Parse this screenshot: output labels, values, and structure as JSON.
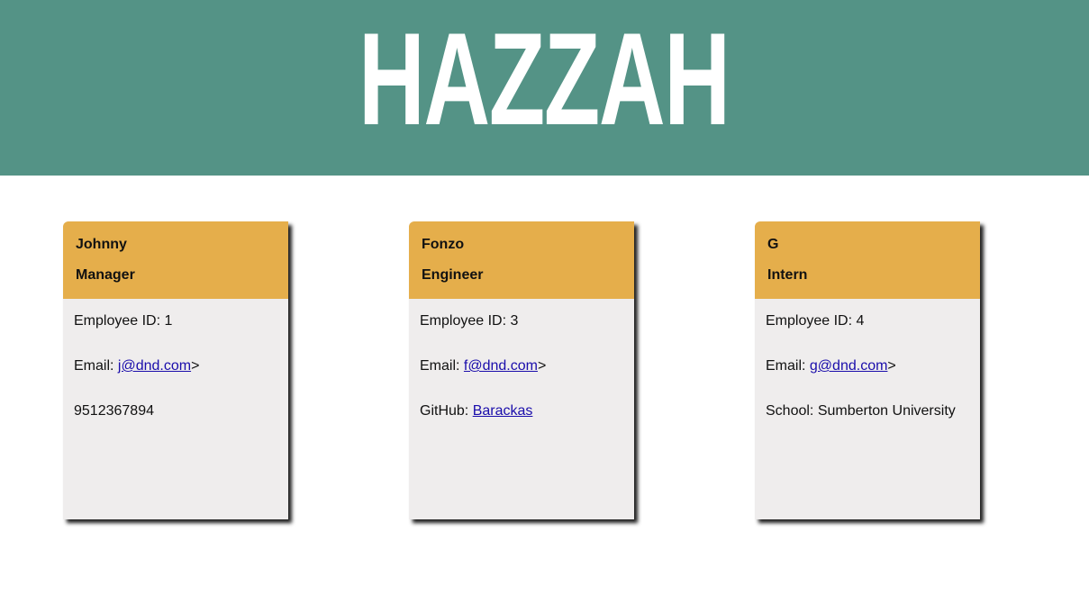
{
  "header": {
    "title": "HAZZAH"
  },
  "cards": [
    {
      "name": "Johnny",
      "role": "Manager",
      "id_label": "Employee ID: ",
      "id_value": "1",
      "email_label": "Email: ",
      "email": "j@dnd.com",
      "email_suffix": ">",
      "extra_label": "",
      "extra_value": "9512367894"
    },
    {
      "name": "Fonzo",
      "role": "Engineer",
      "id_label": "Employee ID: ",
      "id_value": "3",
      "email_label": "Email: ",
      "email": "f@dnd.com",
      "email_suffix": ">",
      "extra_label": "GitHub: ",
      "extra_value": "Barackas"
    },
    {
      "name": "G",
      "role": "Intern",
      "id_label": "Employee ID: ",
      "id_value": "4",
      "email_label": "Email: ",
      "email": "g@dnd.com",
      "email_suffix": ">",
      "extra_label": "School: ",
      "extra_value": "Sumberton University"
    }
  ],
  "colors": {
    "banner": "#549386",
    "card_header": "#e5ae4b",
    "card_body": "#efeded",
    "link": "#1a0dab"
  }
}
